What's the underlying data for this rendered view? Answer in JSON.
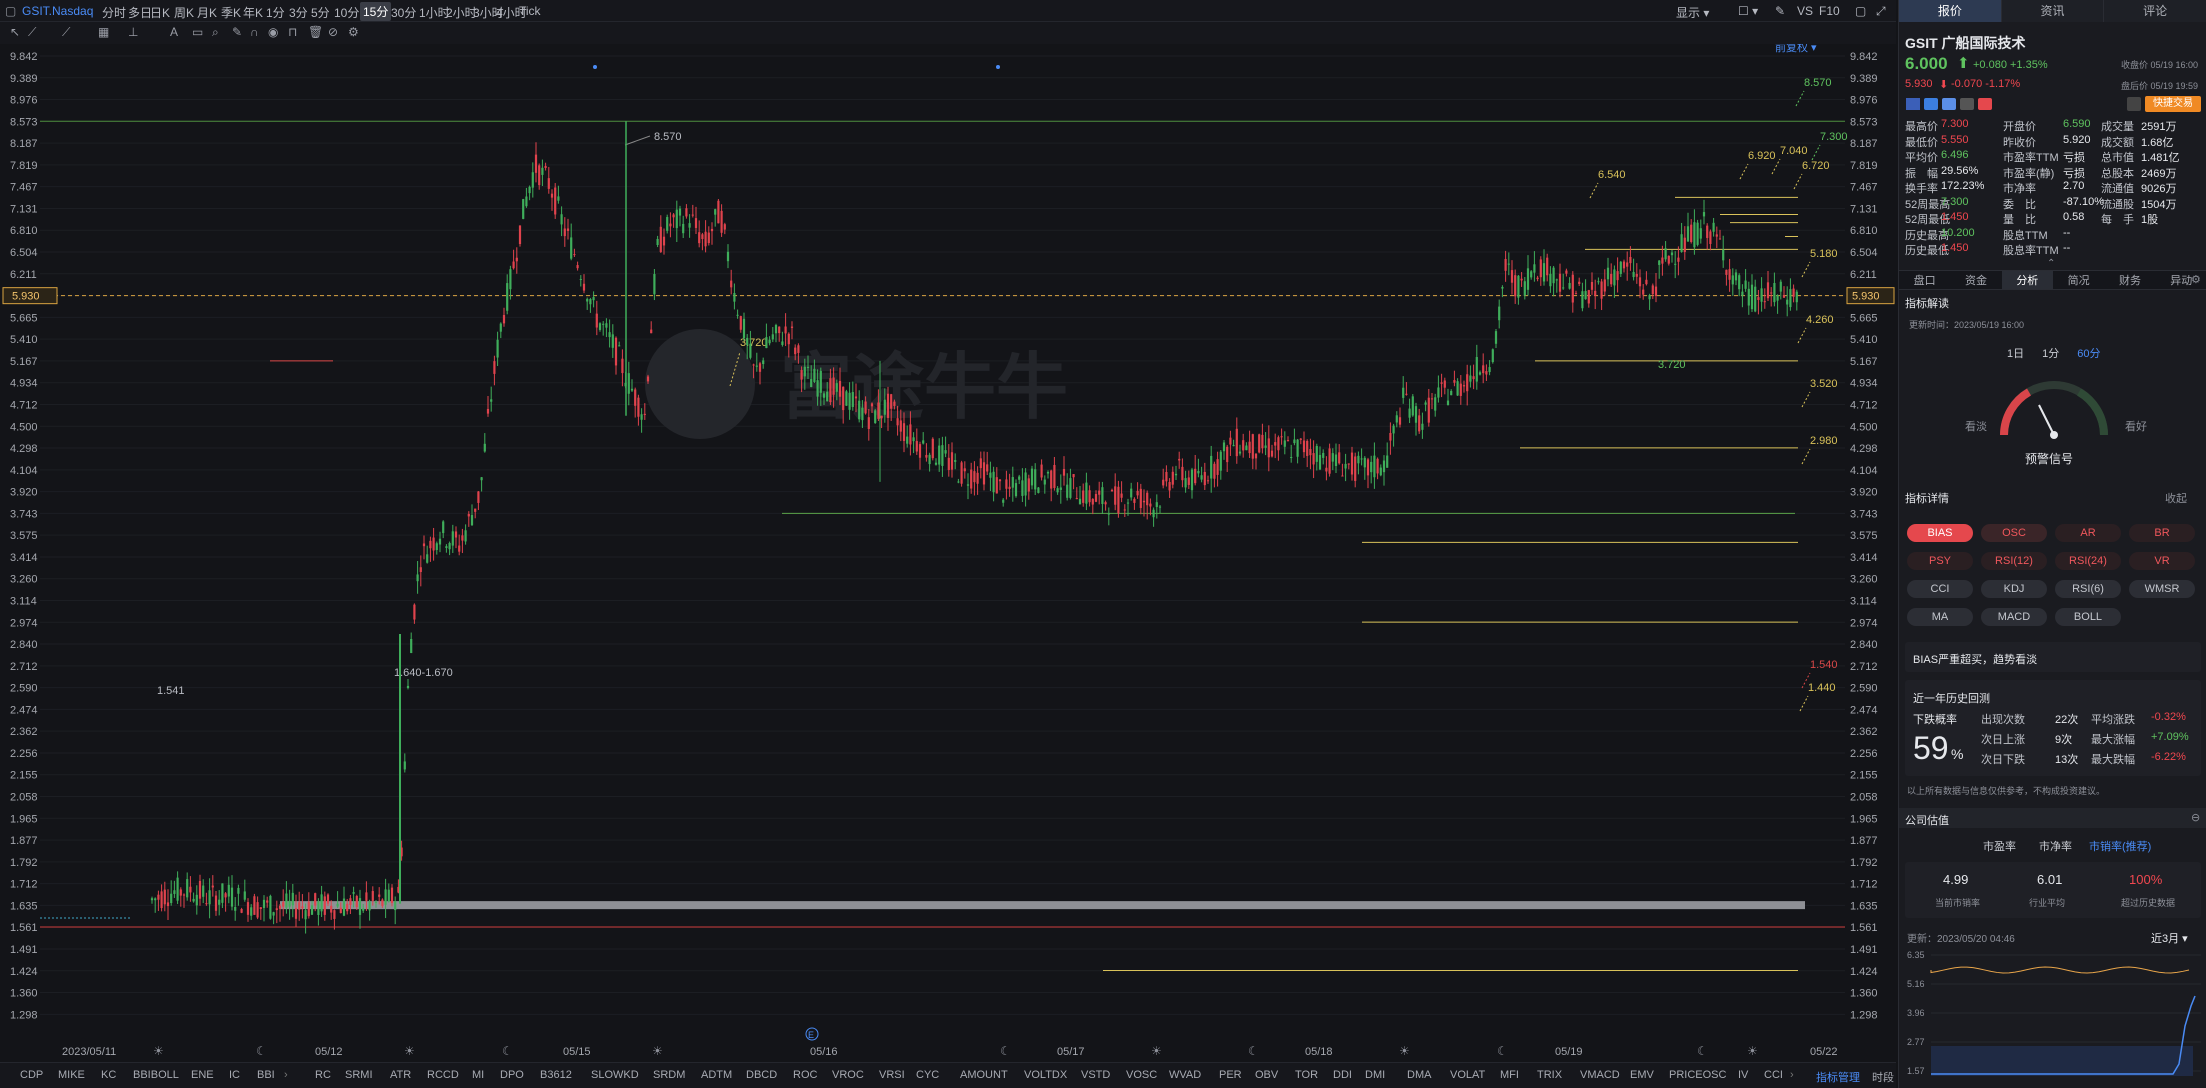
{
  "toolbar": {
    "symbol": "GSIT.Nasdaq",
    "periods": [
      "分时",
      "多日",
      "日K",
      "周K",
      "月K",
      "季K",
      "年K",
      "1分",
      "3分",
      "5分",
      "10分",
      "15分",
      "30分",
      "1小时",
      "2小时",
      "3小时",
      "4小时",
      "Tick"
    ],
    "active_period": "15分",
    "right_items": [
      "显示",
      "VS",
      "F10"
    ],
    "fq": "前复权"
  },
  "price_axis": [
    "9.842",
    "9.389",
    "8.976",
    "8.573",
    "8.187",
    "7.819",
    "7.467",
    "7.131",
    "6.810",
    "6.504",
    "6.211",
    "5.930",
    "5.665",
    "5.410",
    "5.167",
    "4.934",
    "4.712",
    "4.500",
    "4.298",
    "4.104",
    "3.920",
    "3.743",
    "3.575",
    "3.414",
    "3.260",
    "3.114",
    "2.974",
    "2.840",
    "2.712",
    "2.590",
    "2.474",
    "2.362",
    "2.256",
    "2.155",
    "2.058",
    "1.965",
    "1.877",
    "1.792",
    "1.712",
    "1.635",
    "1.561",
    "1.491",
    "1.424",
    "1.360",
    "1.298"
  ],
  "current_price_tag": "5.930",
  "chart_labels": {
    "hline_8570": "8.570",
    "range_label": "1.640-1.670",
    "low_label": "1.541",
    "label_3720_a": "3.720",
    "label_3720_b": "3.720",
    "right_labels": [
      "8.570",
      "7.300",
      "7.040",
      "6.920",
      "6.720",
      "6.540",
      "5.180",
      "4.260",
      "3.520",
      "2.980",
      "1.540",
      "1.440"
    ],
    "watermark": "富途牛牛",
    "event_marker": "E"
  },
  "dates": [
    "2023/05/11",
    "05/12",
    "05/15",
    "05/16",
    "05/17",
    "05/18",
    "05/19",
    "05/22"
  ],
  "indicators": [
    "CDP",
    "MIKE",
    "KC",
    "BBIBOLL",
    "ENE",
    "IC",
    "BBI",
    "RC",
    "SRMI",
    "ATR",
    "RCCD",
    "MI",
    "DPO",
    "B3612",
    "SLOWKD",
    "SRDM",
    "ADTM",
    "DBCD",
    "ROC",
    "VROC",
    "VRSI",
    "CYC",
    "AMOUNT",
    "VOLTDX",
    "VSTD",
    "VOSC",
    "WVAD",
    "PER",
    "OBV",
    "TOR",
    "DDI",
    "DMI",
    "DMA",
    "VOLAT",
    "MFI",
    "TRIX",
    "VMACD",
    "EMV",
    "PRICEOSC",
    "IV",
    "CCI"
  ],
  "bottom_right": [
    "指标管理",
    "时段"
  ],
  "panel": {
    "tabs": [
      "报价",
      "资讯",
      "评论"
    ],
    "title": "GSIT  广船国际技术",
    "price": "6.000",
    "change": "+0.080 +1.35%",
    "close_time": "收盘价 05/19 16:00",
    "after_price": "5.930",
    "after_change": "-0.070 -1.17%",
    "after_time": "盘后价 05/19 19:59",
    "quick_trade": "快捷交易",
    "quote_rows": [
      [
        [
          "最高价",
          "7.300",
          "red"
        ],
        [
          "开盘价",
          "6.590",
          "grn"
        ],
        [
          "成交量",
          "2591万",
          ""
        ]
      ],
      [
        [
          "最低价",
          "5.550",
          "red"
        ],
        [
          "昨收价",
          "5.920",
          ""
        ],
        [
          "成交额",
          "1.68亿",
          ""
        ]
      ],
      [
        [
          "平均价",
          "6.496",
          "grn"
        ],
        [
          "市盈率TTM",
          "亏损",
          ""
        ],
        [
          "总市值",
          "1.481亿",
          ""
        ]
      ],
      [
        [
          "振　幅",
          "29.56%",
          ""
        ],
        [
          "市盈率(静)",
          "亏损",
          ""
        ],
        [
          "总股本",
          "2469万",
          ""
        ]
      ],
      [
        [
          "换手率",
          "172.23%",
          ""
        ],
        [
          "市净率",
          "2.70",
          ""
        ],
        [
          "流通值",
          "9026万",
          ""
        ]
      ],
      [
        [
          "52周最高",
          "7.300",
          "grn"
        ],
        [
          "委　比",
          "-87.10%",
          ""
        ],
        [
          "流通股",
          "1504万",
          ""
        ]
      ],
      [
        [
          "52周最低",
          "1.450",
          "red"
        ],
        [
          "量　比",
          "0.58",
          ""
        ],
        [
          "每　手",
          "1股",
          ""
        ]
      ],
      [
        [
          "历史最高",
          "10.200",
          "grn"
        ],
        [
          "股息TTM",
          "--",
          ""
        ]
      ],
      [
        [
          "历史最低",
          "1.450",
          "red"
        ],
        [
          "股息率TTM",
          "--",
          ""
        ]
      ]
    ],
    "subtabs": [
      "盘口",
      "资金",
      "分析",
      "简况",
      "财务",
      "异动"
    ],
    "active_sub": "分析",
    "ind_title": "指标解读",
    "update_time": "更新时间：2023/05/19 16:00",
    "gauge_periods": [
      "1日",
      "1分",
      "60分"
    ],
    "gauge_left": "看淡",
    "gauge_right": "看好",
    "gauge_label": "预警信号",
    "detail_title": "指标详情",
    "collapse": "收起",
    "pills": [
      "BIAS",
      "OSC",
      "AR",
      "BR",
      "PSY",
      "RSI(12)",
      "RSI(24)",
      "VR",
      "CCI",
      "KDJ",
      "RSI(6)",
      "WMSR",
      "MA",
      "MACD",
      "BOLL"
    ],
    "signal_text": "BIAS严重超买，趋势看淡",
    "history_title": "近一年历史回测",
    "down_prob_label": "下跌概率",
    "down_prob": "59",
    "pct": "%",
    "stats": [
      [
        "出现次数",
        "22次",
        "平均涨跌",
        "-0.32%"
      ],
      [
        "次日上涨",
        "9次",
        "最大涨幅",
        "+7.09%"
      ],
      [
        "次日下跌",
        "13次",
        "最大跌幅",
        "-6.22%"
      ]
    ],
    "disclaimer": "以上所有数据与信息仅供参考，不构成投资建议。",
    "valuation_title": "公司估值",
    "val_tabs": [
      "市盈率",
      "市净率",
      "市销率(推荐)"
    ],
    "val_values": [
      "4.99",
      "6.01",
      "100%"
    ],
    "val_labels": [
      "当前市销率",
      "行业平均",
      "超过历史数据"
    ],
    "val_update": "更新：2023/05/20 04:46",
    "val_range": "近3月",
    "val_axis": [
      "6.35",
      "5.16",
      "3.96",
      "2.77",
      "1.57"
    ]
  }
}
